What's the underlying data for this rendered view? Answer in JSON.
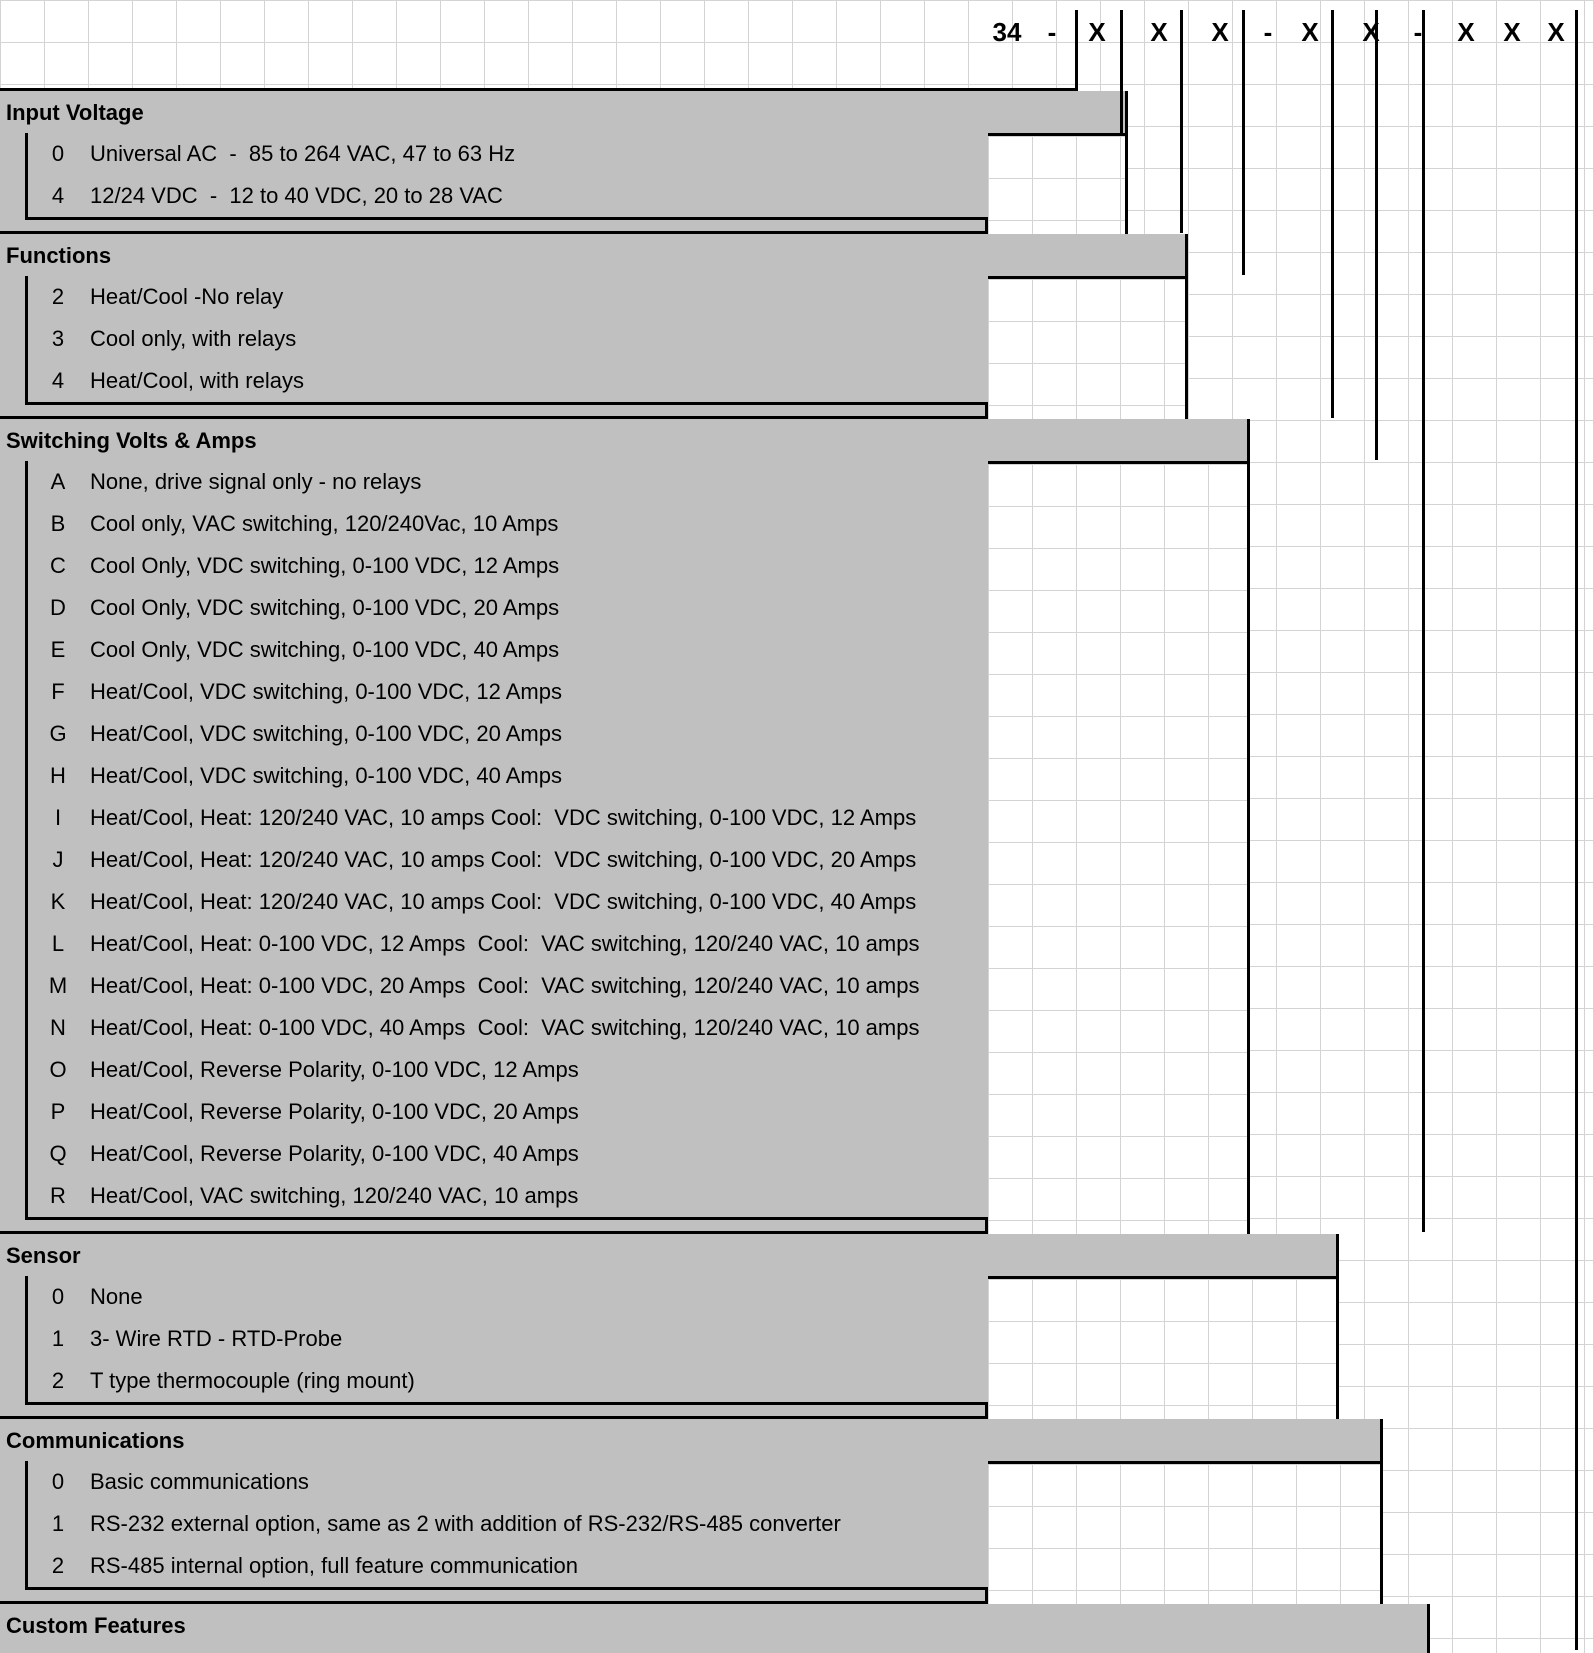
{
  "part_number": [
    "34",
    "-",
    "X",
    "X",
    "X",
    "-",
    "X",
    "X",
    "-",
    "X",
    "X",
    "X"
  ],
  "sections": [
    {
      "title": "Input Voltage",
      "options": [
        {
          "code": "0",
          "description": "Universal AC  -  85 to 264 VAC, 47 to 63 Hz"
        },
        {
          "code": "4",
          "description": "12/24 VDC  -  12 to 40 VDC, 20 to 28 VAC"
        }
      ]
    },
    {
      "title": "Functions",
      "options": [
        {
          "code": "2",
          "description": "Heat/Cool -No relay"
        },
        {
          "code": "3",
          "description": "Cool only, with relays"
        },
        {
          "code": "4",
          "description": "Heat/Cool, with relays"
        }
      ]
    },
    {
      "title": "Switching Volts & Amps",
      "options": [
        {
          "code": "A",
          "description": "None, drive signal only - no relays"
        },
        {
          "code": "B",
          "description": "Cool only, VAC switching, 120/240Vac, 10 Amps"
        },
        {
          "code": "C",
          "description": "Cool Only, VDC switching, 0-100 VDC, 12 Amps"
        },
        {
          "code": "D",
          "description": "Cool Only, VDC switching, 0-100 VDC, 20 Amps"
        },
        {
          "code": "E",
          "description": "Cool Only, VDC switching, 0-100 VDC, 40 Amps"
        },
        {
          "code": "F",
          "description": "Heat/Cool, VDC switching, 0-100 VDC, 12 Amps"
        },
        {
          "code": "G",
          "description": "Heat/Cool, VDC switching, 0-100 VDC, 20 Amps"
        },
        {
          "code": "H",
          "description": "Heat/Cool, VDC switching, 0-100 VDC, 40 Amps"
        },
        {
          "code": "I",
          "description": "Heat/Cool, Heat: 120/240 VAC, 10 amps Cool:  VDC switching, 0-100 VDC, 12 Amps"
        },
        {
          "code": "J",
          "description": "Heat/Cool, Heat: 120/240 VAC, 10 amps Cool:  VDC switching, 0-100 VDC, 20 Amps"
        },
        {
          "code": "K",
          "description": "Heat/Cool, Heat: 120/240 VAC, 10 amps Cool:  VDC switching, 0-100 VDC, 40 Amps"
        },
        {
          "code": "L",
          "description": "Heat/Cool, Heat: 0-100 VDC, 12 Amps  Cool:  VAC switching, 120/240 VAC, 10 amps"
        },
        {
          "code": "M",
          "description": "Heat/Cool, Heat: 0-100 VDC, 20 Amps  Cool:  VAC switching, 120/240 VAC, 10 amps"
        },
        {
          "code": "N",
          "description": "Heat/Cool, Heat: 0-100 VDC, 40 Amps  Cool:  VAC switching, 120/240 VAC, 10 amps"
        },
        {
          "code": "O",
          "description": "Heat/Cool, Reverse Polarity, 0-100 VDC, 12 Amps"
        },
        {
          "code": "P",
          "description": "Heat/Cool, Reverse Polarity, 0-100 VDC, 20 Amps"
        },
        {
          "code": "Q",
          "description": "Heat/Cool, Reverse Polarity, 0-100 VDC, 40 Amps"
        },
        {
          "code": "R",
          "description": "Heat/Cool, VAC switching, 120/240 VAC, 10 amps"
        }
      ]
    },
    {
      "title": "Sensor",
      "options": [
        {
          "code": "0",
          "description": "None"
        },
        {
          "code": "1",
          "description": "3- Wire RTD - RTD-Probe"
        },
        {
          "code": "2",
          "description": "T type thermocouple (ring mount)"
        }
      ]
    },
    {
      "title": "Communications",
      "options": [
        {
          "code": "0",
          "description": "Basic communications"
        },
        {
          "code": "1",
          "description": "RS-232 external option, same as 2 with addition of RS-232/RS-485 converter"
        },
        {
          "code": "2",
          "description": "RS-485 internal option, full feature communication"
        }
      ]
    },
    {
      "title": "Custom Features",
      "options": []
    }
  ],
  "colors": {
    "panel_fill": "#c0c0c0",
    "outline": "#000000",
    "gridline": "#d4d4d4",
    "background": "#ffffff"
  }
}
